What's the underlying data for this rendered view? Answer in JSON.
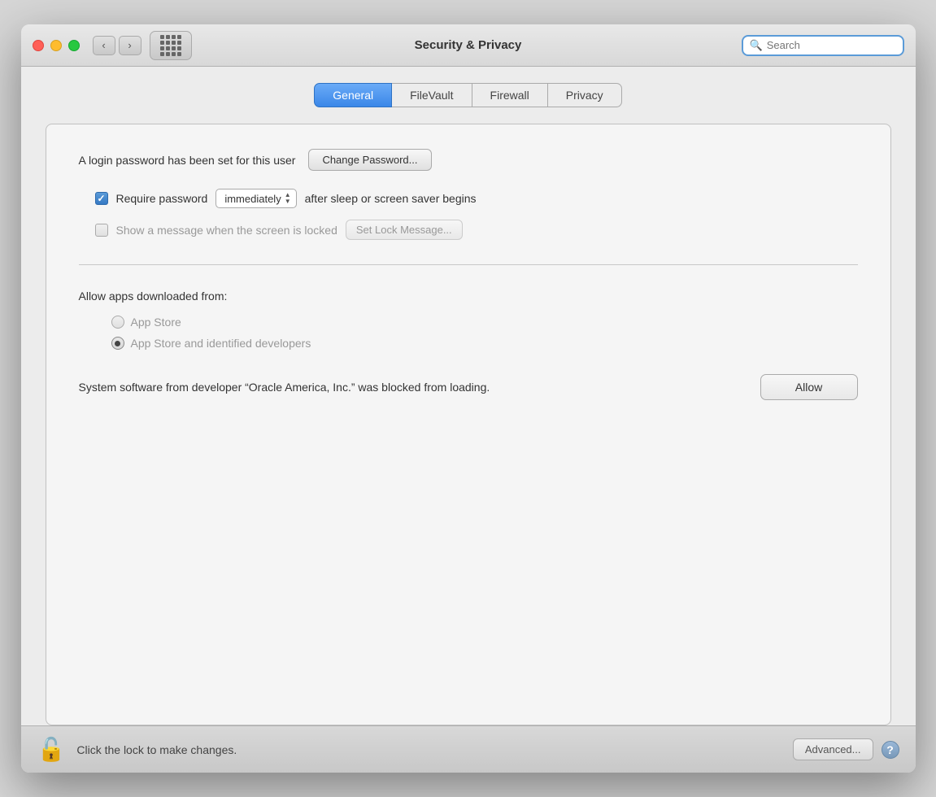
{
  "window": {
    "title": "Security & Privacy",
    "search_placeholder": "Search"
  },
  "tabs": [
    {
      "id": "general",
      "label": "General",
      "active": true
    },
    {
      "id": "filevault",
      "label": "FileVault",
      "active": false
    },
    {
      "id": "firewall",
      "label": "Firewall",
      "active": false
    },
    {
      "id": "privacy",
      "label": "Privacy",
      "active": false
    }
  ],
  "general": {
    "login_password_text": "A login password has been set for this user",
    "change_password_btn": "Change Password...",
    "require_password_label": "Require password",
    "immediately_option": "immediately",
    "after_sleep_text": "after sleep or screen saver begins",
    "lock_message_label": "Show a message when the screen is locked",
    "set_lock_btn": "Set Lock Message...",
    "allow_apps_label": "Allow apps downloaded from:",
    "radio_app_store": "App Store",
    "radio_app_store_developers": "App Store and identified developers",
    "software_blocked_text": "System software from developer “Oracle America, Inc.” was blocked from loading.",
    "allow_btn": "Allow"
  },
  "footer": {
    "lock_text": "Click the lock to make changes.",
    "advanced_btn": "Advanced...",
    "help_label": "?"
  },
  "nav": {
    "back": "‹",
    "forward": "›"
  }
}
